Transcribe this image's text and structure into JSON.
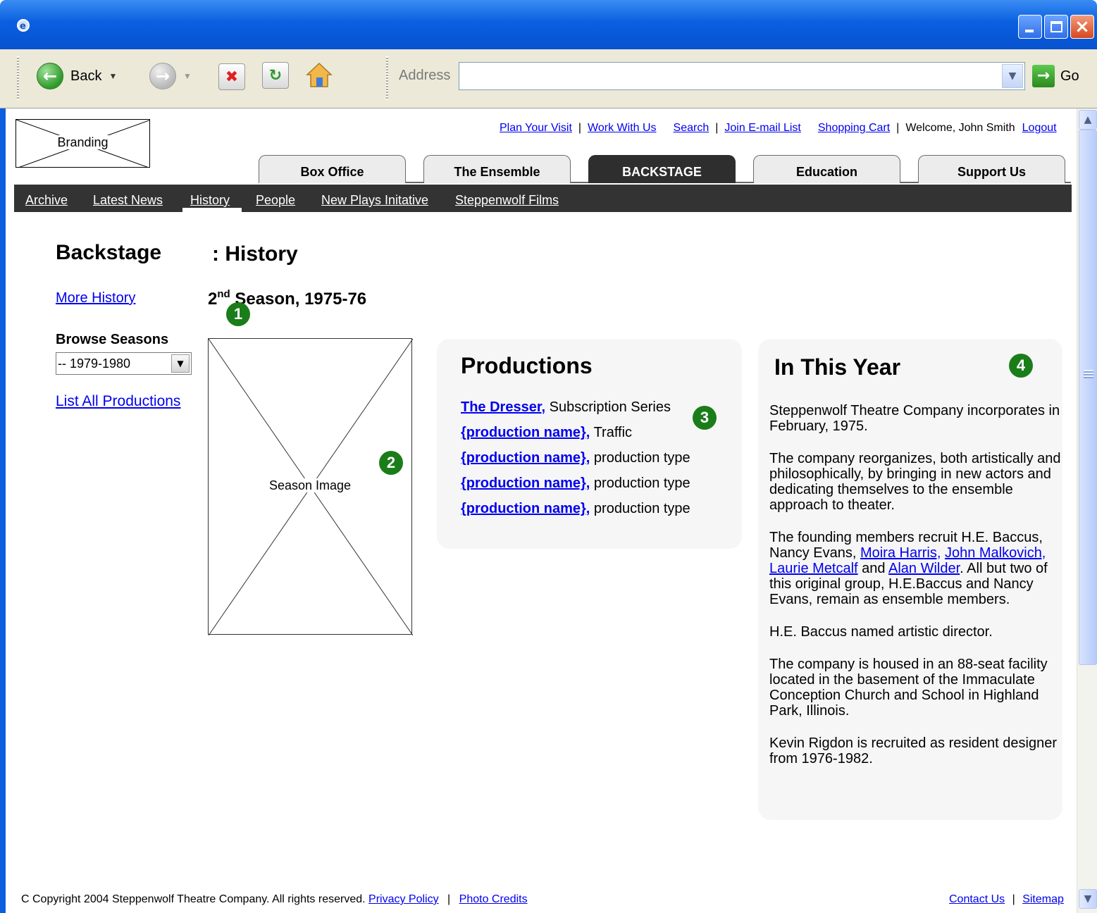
{
  "browser": {
    "back_label": "Back",
    "address_label": "Address",
    "address_value": "",
    "go_label": "Go"
  },
  "branding": {
    "label": "Branding"
  },
  "utility_nav": {
    "plan_visit": "Plan Your Visit",
    "work_with_us": "Work With Us",
    "search": "Search",
    "join_email": "Join E-mail List",
    "shopping_cart": "Shopping Cart",
    "welcome": "Welcome, John Smith",
    "logout": "Logout"
  },
  "tabs": [
    "Box Office",
    "The Ensemble",
    "BACKSTAGE",
    "Education",
    "Support Us"
  ],
  "subnav": [
    "Archive",
    "Latest News",
    "History",
    "People",
    "New Plays Initative",
    "Steppenwolf Films"
  ],
  "page": {
    "section_title": "Backstage",
    "page_title": ": History",
    "more_history": "More History",
    "season_title_num": "2",
    "season_title_sup": "nd",
    "season_title_rest": " Season, 1975-76",
    "browse_label": "Browse Seasons",
    "browse_value": "-- 1979-1980",
    "list_all": "List All Productions",
    "season_image_label": "Season Image"
  },
  "productions": {
    "title": "Productions",
    "items": [
      {
        "name": "The Dresser,",
        "type": "Subscription Series"
      },
      {
        "name": "{production name},",
        "type": "Traffic"
      },
      {
        "name": "{production name},",
        "type": "production type"
      },
      {
        "name": "{production name},",
        "type": "production type"
      },
      {
        "name": "{production name},",
        "type": "production type"
      }
    ]
  },
  "in_this_year": {
    "title": "In This Year",
    "p1": "Steppenwolf Theatre Company incorporates in February, 1975.",
    "p2": "The company reorganizes, both artistically and philosophically, by bringing in new actors and dedicating themselves to the ensemble approach to theater.",
    "p3_start": "The founding members recruit H.E. Baccus, Nancy Evans, ",
    "p3_link1": "Moira Harris,",
    "p3_link2": "John Malkovich,",
    "p3_link3": "Laurie Metcalf",
    "p3_and": " and ",
    "p3_link4": "Alan Wilder",
    "p3_end": ". All but two of this original group, H.E.Baccus and Nancy Evans, remain as ensemble members.",
    "p4": "H.E. Baccus named artistic director.",
    "p5": "The company is housed in an 88-seat facility located in the basement of the Immaculate Conception Church and School in Highland Park, Illinois.",
    "p6": "Kevin Rigdon is recruited as resident designer from 1976-1982."
  },
  "markers": [
    "1",
    "2",
    "3",
    "4"
  ],
  "footer": {
    "copyright": "C Copyright 2004 Steppenwolf Theatre Company. All rights reserved.",
    "privacy": "Privacy Policy",
    "photo_credits": "Photo Credits",
    "contact": "Contact Us",
    "sitemap": "Sitemap"
  },
  "colors": {
    "title_bar": "#0a5fe0",
    "link": "#0000ee",
    "marker": "#1a7d1a",
    "subnav_bg": "#333333",
    "active_tab": "#2e2e2e"
  }
}
